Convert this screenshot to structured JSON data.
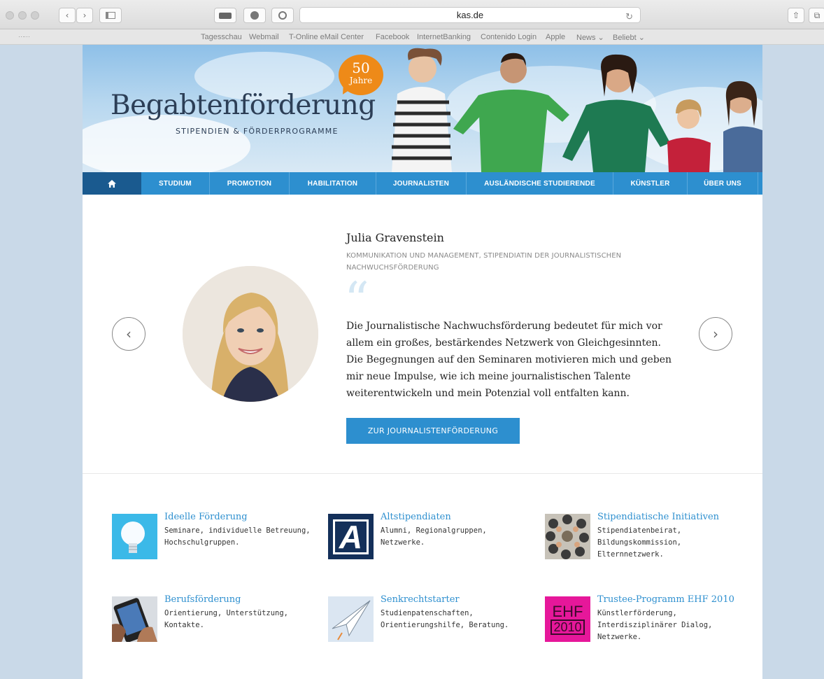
{
  "browser": {
    "address": "kas.de",
    "bookmarks": [
      "Tagesschau",
      "Webmail",
      "T-Online eMail Center",
      "Facebook",
      "InternetBanking",
      "Contenido Login",
      "Apple",
      "News ⌄",
      "Beliebt ⌄"
    ]
  },
  "hero": {
    "title": "Begabtenförderung",
    "subtitle": "STIPENDIEN & FÖRDERPROGRAMME",
    "badge_number": "50",
    "badge_text": "Jahre"
  },
  "nav": {
    "home_icon": "home-icon",
    "items": [
      "STUDIUM",
      "PROMOTION",
      "HABILITATION",
      "JOURNALISTEN",
      "AUSLÄNDISCHE STUDIERENDE",
      "KÜNSTLER",
      "ÜBER UNS"
    ]
  },
  "slider": {
    "name": "Julia Gravenstein",
    "role": "KOMMUNIKATION UND MANAGEMENT, STIPENDIATIN DER JOURNALISTISCHEN NACHWUCHSFÖRDERUNG",
    "quote": "Die Journalistische Nachwuchsförderung bedeutet für mich vor allem ein großes, bestärkendes Netzwerk von Gleichgesinnten. Die Begegnungen auf den Seminaren motivieren mich und geben mir neue Impulse, wie ich meine journalistischen Talente weiterentwickeln und mein Potenzial voll entfalten kann.",
    "cta": "ZUR JOURNALISTENFÖRDERUNG",
    "prev_icon": "chevron-left-icon",
    "next_icon": "chevron-right-icon"
  },
  "features": [
    {
      "title": "Ideelle Förderung",
      "desc": "Seminare, individuelle Betreuung, Hochschulgruppen."
    },
    {
      "title": "Altstipendiaten",
      "desc": "Alumni, Regionalgruppen, Netzwerke."
    },
    {
      "title": "Stipendiatische Initiativen",
      "desc": "Stipendiatenbeirat, Bildungskommission, Elternnetzwerk."
    },
    {
      "title": "Berufsförderung",
      "desc": "Orientierung, Unterstützung, Kontakte."
    },
    {
      "title": "Senkrechtstarter",
      "desc": "Studienpatenschaften, Orientierungshilfe, Beratung."
    },
    {
      "title": "Trustee-Programm EHF 2010",
      "desc": "Künstlerförderung, Interdisziplinärer Dialog, Netzwerke."
    }
  ],
  "feature_logos": {
    "altstipendiaten": "A",
    "ehf_line1": "EHF",
    "ehf_line2": "2010"
  },
  "colors": {
    "accent": "#2d8fcf",
    "nav_home": "#1a5a8f",
    "badge": "#ee8a18"
  }
}
